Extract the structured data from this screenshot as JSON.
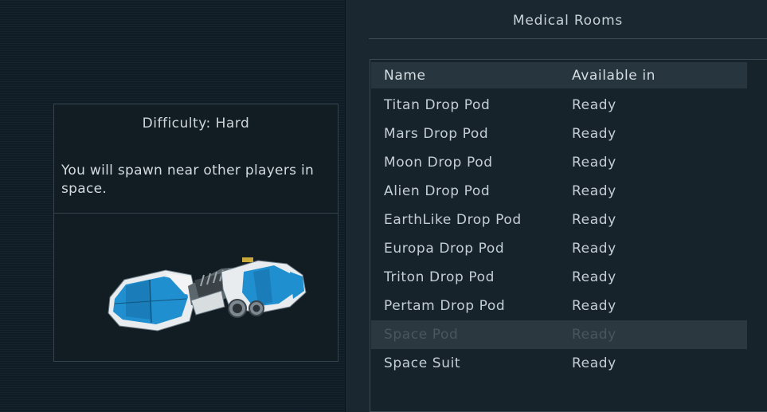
{
  "info_card": {
    "difficulty": "Difficulty: Hard",
    "description": "You will spawn near other players in space.",
    "preview_icon": "drop-pod-ship-preview"
  },
  "panel": {
    "title": "Medical Rooms"
  },
  "table": {
    "headers": {
      "name": "Name",
      "available": "Available in"
    },
    "rows": [
      {
        "name": "Titan Drop Pod",
        "status": "Ready",
        "enabled": true
      },
      {
        "name": "Mars Drop Pod",
        "status": "Ready",
        "enabled": true
      },
      {
        "name": "Moon Drop Pod",
        "status": "Ready",
        "enabled": true
      },
      {
        "name": "Alien Drop Pod",
        "status": "Ready",
        "enabled": true
      },
      {
        "name": "EarthLike Drop Pod",
        "status": "Ready",
        "enabled": true
      },
      {
        "name": "Europa Drop Pod",
        "status": "Ready",
        "enabled": true
      },
      {
        "name": "Triton Drop Pod",
        "status": "Ready",
        "enabled": true
      },
      {
        "name": "Pertam Drop Pod",
        "status": "Ready",
        "enabled": true
      },
      {
        "name": "Space Pod",
        "status": "Ready",
        "enabled": false
      },
      {
        "name": "Space Suit",
        "status": "Ready",
        "enabled": true
      }
    ]
  },
  "colors": {
    "background": "#0f1a22",
    "panel": "#1a2730",
    "text": "#c5ced4",
    "disabled_text": "#48565e",
    "ship_blue": "#1f8fd0"
  }
}
